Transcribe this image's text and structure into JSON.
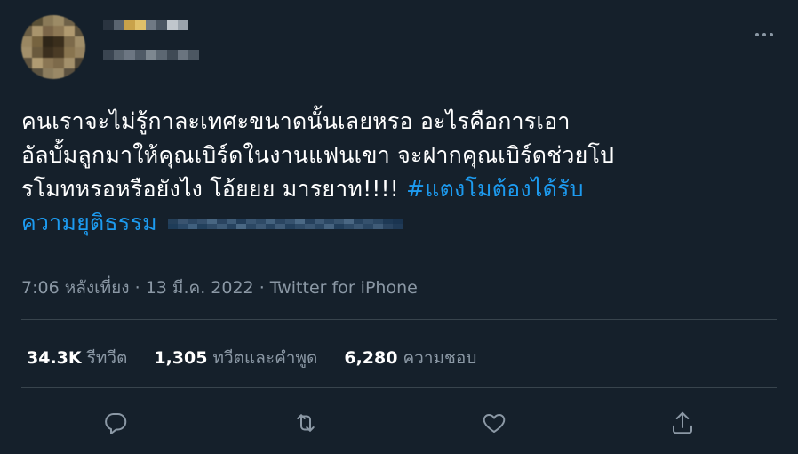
{
  "tweet": {
    "lines": [
      "คนเราจะไม่รู้กาละเทศะขนาดนั้นเลยหรอ อะไรคือการเอา",
      "อัลบั้มลูกมาให้คุณเบิร์ดในงานแฟนเขา จะฝากคุณเบิร์ดช่วยโป",
      "รโมทหรอหรือยังไง โอ้ยยย มารยาท!!!! "
    ],
    "hashtag_part1": "#แตงโมต้องได้รับ",
    "hashtag_part2": "ความยุติธรรม"
  },
  "meta": {
    "time": "7:06 หลังเที่ยง",
    "sep1": " · ",
    "date": "13 มี.ค. 2022",
    "sep2": " · ",
    "source": "Twitter for iPhone"
  },
  "stats": {
    "retweets_count": "34.3K",
    "retweets_label": "รีทวีต",
    "quotes_count": "1,305",
    "quotes_label": "ทวีตและคำพูด",
    "likes_count": "6,280",
    "likes_label": "ความชอบ"
  },
  "icons": {
    "more": "more-horizontal-icon",
    "reply": "reply-icon",
    "retweet": "retweet-icon",
    "like": "heart-icon",
    "share": "share-icon"
  },
  "colors": {
    "background": "#15202b",
    "text": "#ffffff",
    "secondary": "#8b98a5",
    "accent": "#1d9bf0",
    "divider": "#38444d"
  }
}
